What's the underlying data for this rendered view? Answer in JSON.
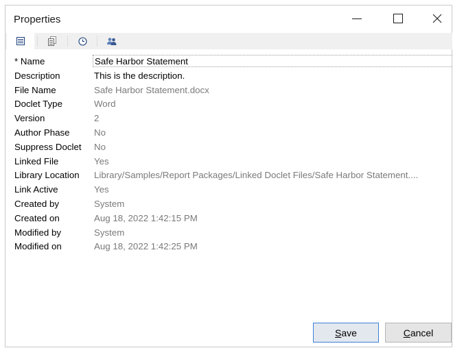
{
  "window": {
    "title": "Properties",
    "minimize_glyph": "—",
    "close_glyph": "✕"
  },
  "tabs": [
    {
      "icon": "property-grid-icon",
      "active": true
    },
    {
      "icon": "document-versions-icon",
      "active": false
    },
    {
      "icon": "history-clock-icon",
      "active": false
    },
    {
      "icon": "users-permissions-icon",
      "active": false
    }
  ],
  "properties": [
    {
      "label": "* Name",
      "value": "Safe Harbor Statement"
    },
    {
      "label": "Description",
      "value": "This is the description."
    },
    {
      "label": "File Name",
      "value": "Safe Harbor Statement.docx"
    },
    {
      "label": "Doclet Type",
      "value": "Word"
    },
    {
      "label": "Version",
      "value": "2"
    },
    {
      "label": "Author Phase",
      "value": "No"
    },
    {
      "label": "Suppress Doclet",
      "value": "No"
    },
    {
      "label": "Linked File",
      "value": "Yes"
    },
    {
      "label": "Library Location",
      "value": "Library/Samples/Report Packages/Linked Doclet Files/Safe Harbor Statement...."
    },
    {
      "label": "Link Active",
      "value": "Yes"
    },
    {
      "label": "Created by",
      "value": "System"
    },
    {
      "label": "Created on",
      "value": "Aug 18, 2022 1:42:15 PM"
    },
    {
      "label": "Modified by",
      "value": "System"
    },
    {
      "label": "Modified on",
      "value": "Aug 18, 2022 1:42:25 PM"
    }
  ],
  "buttons": {
    "save": {
      "mnemonic": "S",
      "rest": "ave"
    },
    "cancel": {
      "mnemonic": "C",
      "rest": "ancel"
    }
  }
}
